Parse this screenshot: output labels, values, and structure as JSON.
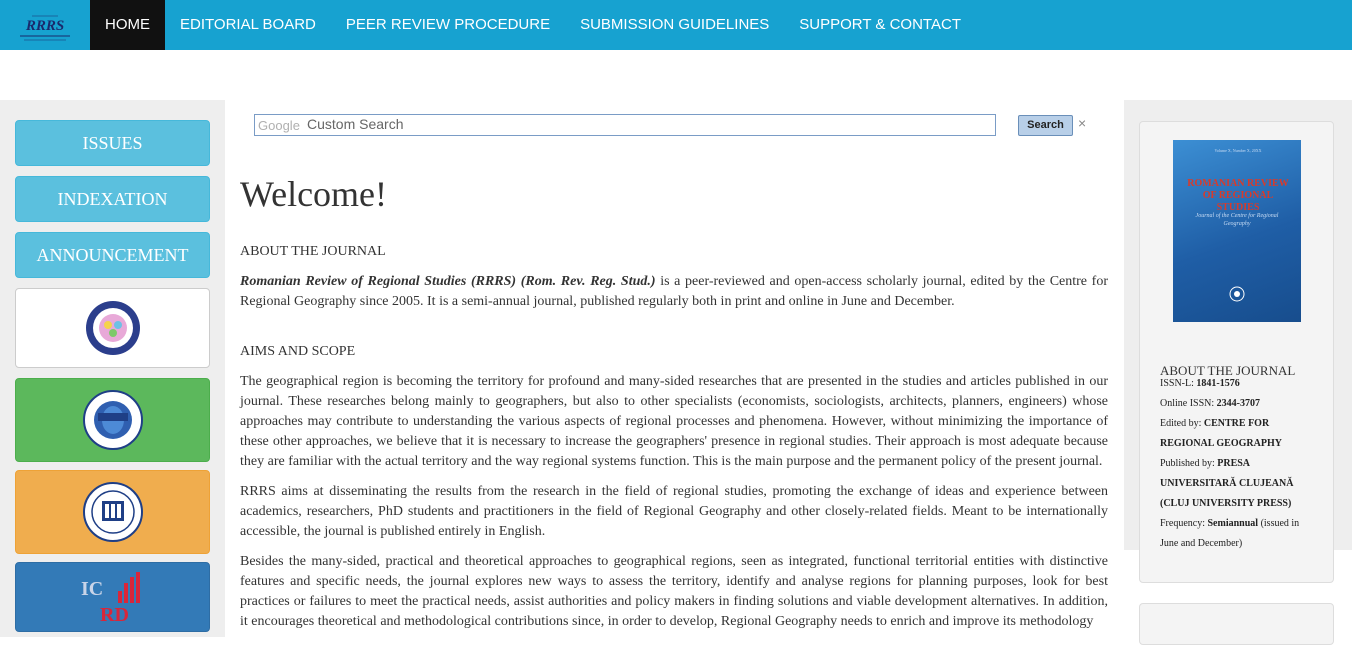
{
  "nav": {
    "logo_text": "RRRS",
    "items": [
      {
        "label": "HOME",
        "active": true
      },
      {
        "label": "EDITORIAL BOARD",
        "active": false
      },
      {
        "label": "PEER REVIEW PROCEDURE",
        "active": false
      },
      {
        "label": "SUBMISSION GUIDELINES",
        "active": false
      },
      {
        "label": "SUPPORT & CONTACT",
        "active": false
      }
    ]
  },
  "sidebar": {
    "buttons": [
      "ISSUES",
      "INDEXATION",
      "ANNOUNCEMENT"
    ],
    "logo_boxes": [
      {
        "name": "logo-seal-blue",
        "bg": "#ffffff"
      },
      {
        "name": "logo-university-romania",
        "bg": "#5cb85c"
      },
      {
        "name": "logo-university-cluj",
        "bg": "#f0ad4e"
      },
      {
        "name": "logo-ic-rd",
        "bg": "#337ab7",
        "text_top": "IC",
        "text_bottom": "RD"
      }
    ]
  },
  "search": {
    "brand": "Google",
    "placeholder": "Custom Search",
    "button_label": "Search",
    "clear_symbol": "×"
  },
  "content": {
    "heading": "Welcome!",
    "about_title": "ABOUT THE JOURNAL",
    "about_italic": "Romanian Review of Regional Studies (RRRS) (Rom. Rev. Reg. Stud.)",
    "about_text": " is a peer-reviewed and open-access scholarly journal, edited by the Centre for Regional Geography since 2005. It is a semi-annual journal, published regularly both in print and online in June and December.",
    "aims_title": "AIMS AND SCOPE",
    "aims_p1": "The geographical region is becoming the territory for profound and many-sided researches that are presented in the studies and articles published in our journal. These researches belong mainly to geographers, but also to other specialists (economists, sociologists, architects, planners, engineers) whose approaches may contribute to understanding the various aspects of regional processes and phenomena. However, without minimizing the importance of these other approaches, we believe that it is necessary to increase the geographers' presence in regional studies. Their approach is most adequate because they are familiar with the actual territory and the way regional systems function. This is the main purpose and the permanent policy of the present journal.",
    "aims_p2": "RRRS aims at disseminating the results from the research in the field of regional studies, promoting the exchange of ideas and experience between academics, researchers, PhD students and practitioners in the field of Regional Geography and other closely-related fields. Meant to be internationally accessible, the journal is published entirely in English.",
    "aims_p3": "Besides the many-sided, practical and theoretical approaches to geographical regions, seen as integrated, functional territorial entities with distinctive features and specific needs, the journal explores new ways to assess the territory, identify and analyse regions for planning purposes, look for best practices or failures to meet the practical needs, assist authorities and policy makers in finding solutions and viable development alternatives. In addition, it encourages theoretical and methodological contributions since, in order to develop, Regional Geography needs to enrich and improve its methodology"
  },
  "right": {
    "cover": {
      "volume": "Volume X, Number X, 20XX",
      "title": "ROMANIAN REVIEW OF REGIONAL STUDIES",
      "subtitle": "Journal of the Centre for Regional Geography"
    },
    "heading": "ABOUT THE JOURNAL",
    "issn_l_label": "ISSN-L: ",
    "issn_l": "1841-1576",
    "online_issn_label": "Online ISSN: ",
    "online_issn": "2344-3707",
    "edited_by_label": "Edited by: ",
    "edited_by_1": "CENTRE FOR",
    "edited_by_2": "REGIONAL GEOGRAPHY",
    "published_by_label": "Published by: ",
    "published_by_1": "PRESA",
    "published_by_2": "UNIVERSITARĂ CLUJEANĂ",
    "published_by_3": "(CLUJ UNIVERSITY PRESS)",
    "frequency_label": "Frequency: ",
    "frequency": "Semiannual",
    "frequency_note_1": " (issued in",
    "frequency_note_2": "June and December)"
  }
}
